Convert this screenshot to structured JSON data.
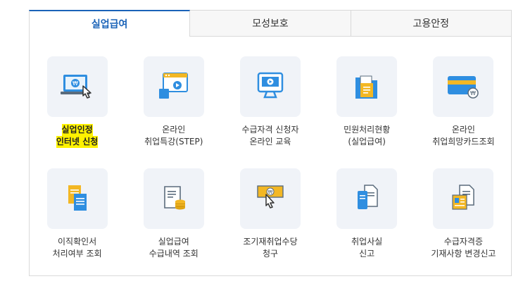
{
  "tabs": [
    {
      "label": "실업급여",
      "active": true
    },
    {
      "label": "모성보호",
      "active": false
    },
    {
      "label": "고용안정",
      "active": false
    }
  ],
  "items": [
    {
      "line1": "실업인정",
      "line2": "인터넷 신청",
      "icon": "laptop-click-icon",
      "highlight": true
    },
    {
      "line1": "온라인",
      "line2": "취업특강(STEP)",
      "icon": "video-lecture-icon"
    },
    {
      "line1": "수급자격 신청자",
      "line2": "온라인 교육",
      "icon": "monitor-play-icon"
    },
    {
      "line1": "민원처리현황",
      "line2": "(실업급여)",
      "icon": "folder-document-icon"
    },
    {
      "line1": "온라인",
      "line2": "취업희망카드조회",
      "icon": "card-won-icon"
    },
    {
      "line1": "이직확인서",
      "line2": "처리여부 조회",
      "icon": "documents-icon"
    },
    {
      "line1": "실업급여",
      "line2": "수급내역 조회",
      "icon": "scroll-coins-icon"
    },
    {
      "line1": "조기재취업수당",
      "line2": "청구",
      "icon": "hand-money-icon"
    },
    {
      "line1": "취업사실",
      "line2": "신고",
      "icon": "phone-document-icon"
    },
    {
      "line1": "수급자격증",
      "line2": "기재사항 변경신고",
      "icon": "id-document-icon"
    }
  ],
  "colors": {
    "accent": "#1a63b8",
    "tile_bg": "#f0f3f8",
    "highlight": "#fff200",
    "icon_blue": "#2f8ee0",
    "icon_yellow": "#f3b724"
  }
}
